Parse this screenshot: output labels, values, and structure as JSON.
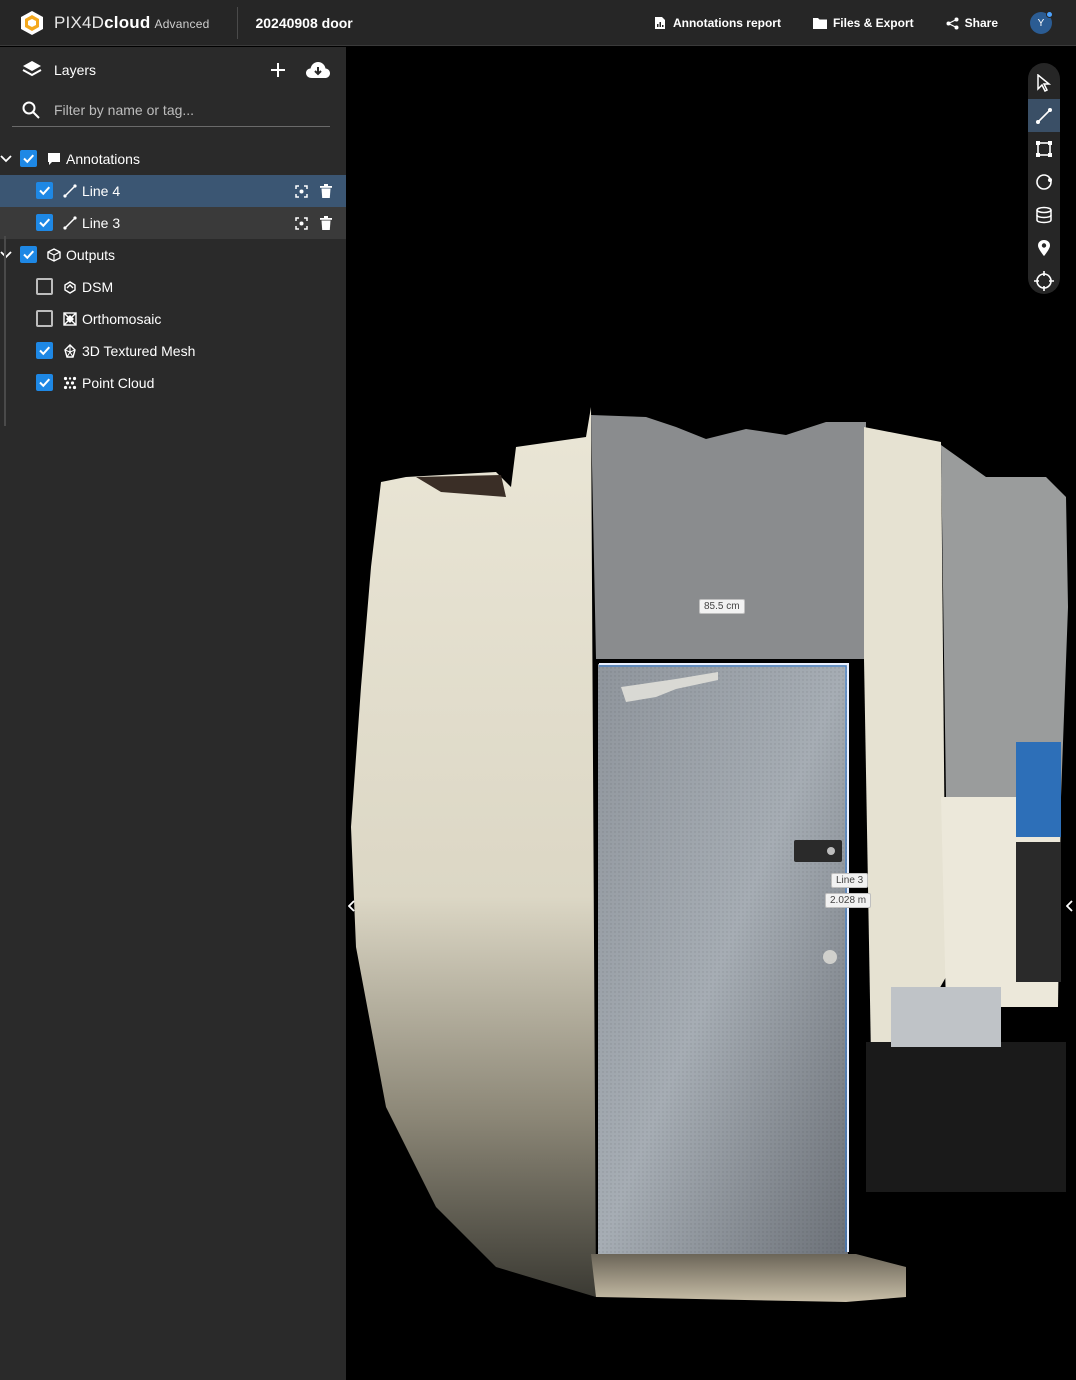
{
  "app": {
    "brand_pre": "PIX4D",
    "brand_bold": "cloud",
    "tier": "Advanced",
    "project_title": "20240908 door"
  },
  "header_actions": {
    "annotations_report": "Annotations report",
    "files_export": "Files & Export",
    "share": "Share",
    "avatar_initial": "Y"
  },
  "sidebar": {
    "title": "Layers",
    "filter_placeholder": "Filter by name or tag...",
    "groups": [
      {
        "label": "Annotations",
        "checked": true,
        "items": [
          {
            "label": "Line 4",
            "checked": true,
            "selected": true
          },
          {
            "label": "Line 3",
            "checked": true,
            "selected": false
          }
        ]
      },
      {
        "label": "Outputs",
        "checked": true,
        "items": [
          {
            "label": "DSM",
            "checked": false,
            "icon": "dsm-icon"
          },
          {
            "label": "Orthomosaic",
            "checked": false,
            "icon": "orthomosaic-icon"
          },
          {
            "label": "3D Textured Mesh",
            "checked": true,
            "icon": "mesh-icon"
          },
          {
            "label": "Point Cloud",
            "checked": true,
            "icon": "point-cloud-icon"
          }
        ]
      }
    ]
  },
  "viewer": {
    "tools": [
      "select-icon",
      "line-measure-icon",
      "polygon-icon",
      "circle-icon",
      "volume-icon",
      "marker-icon",
      "crosshair-icon"
    ],
    "active_tool": "line-measure-icon",
    "measurement_top": "85.5 cm",
    "measurement_line_name": "Line 3",
    "measurement_line_value": "2.028 m"
  },
  "colors": {
    "accent": "#1e88e5",
    "sidebar_bg": "#2a2a2a",
    "topbar_bg": "#262626",
    "selected_row": "#3b5673"
  }
}
